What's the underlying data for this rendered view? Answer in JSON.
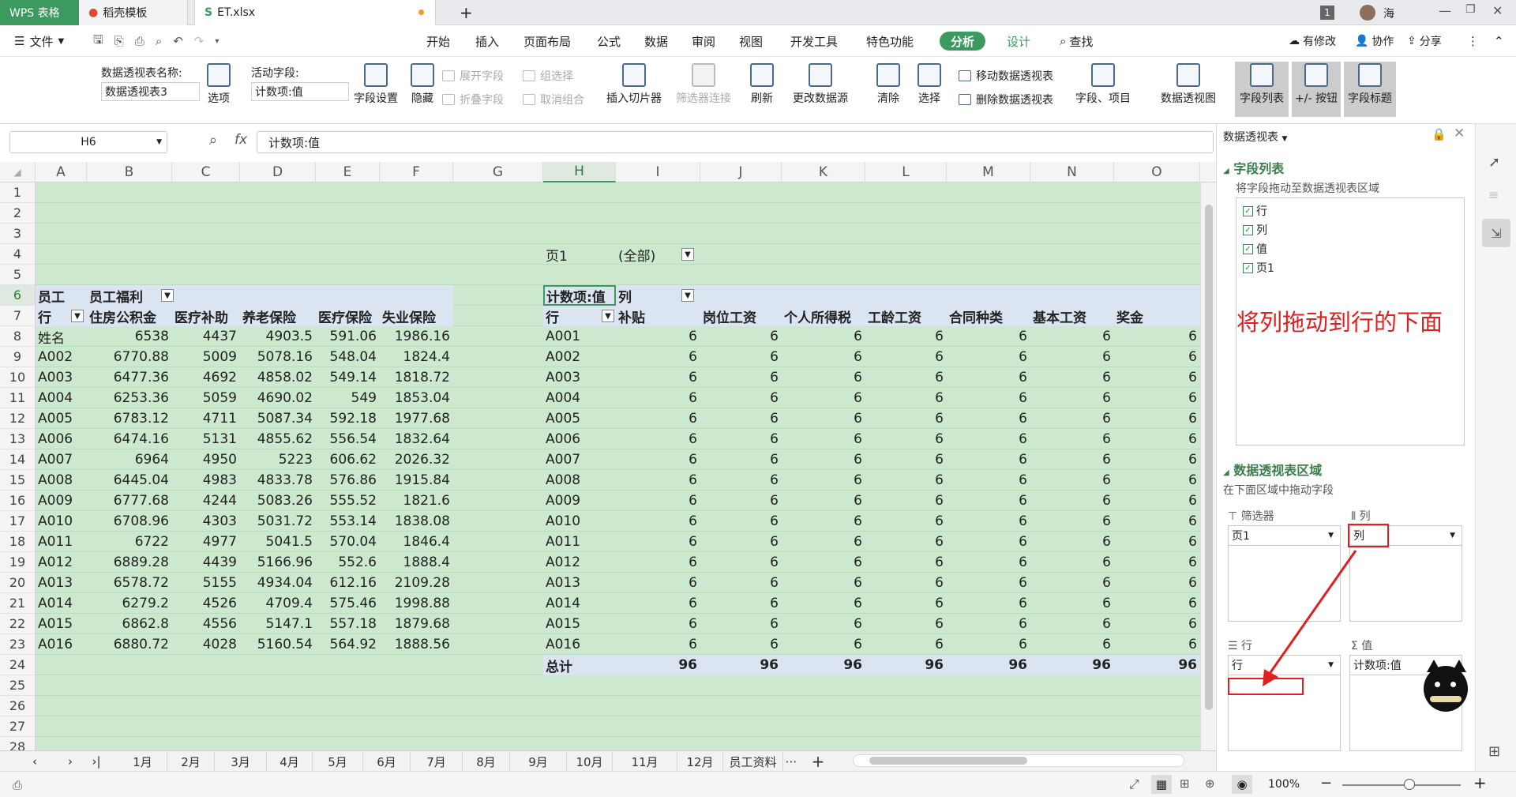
{
  "titlebar": {
    "tab_wps": "WPS 表格",
    "tab_daoke": "稻壳模板",
    "tab_file": "ET.xlsx",
    "new_tab": "+",
    "window_badge": "1",
    "user": "海"
  },
  "menu": {
    "file": "文件",
    "items": [
      "开始",
      "插入",
      "页面布局",
      "公式",
      "数据",
      "审阅",
      "视图",
      "开发工具",
      "特色功能",
      "分析",
      "设计"
    ],
    "search": "查找",
    "has_changes": "有修改",
    "collab": "协作",
    "share": "分享"
  },
  "ribbon": {
    "pivot_name_label": "数据透视表名称:",
    "pivot_name_value": "数据透视表3",
    "options": "选项",
    "active_field_label": "活动字段:",
    "active_field_value": "计数项:值",
    "field_settings": "字段设置",
    "hide": "隐藏",
    "expand_field": "展开字段",
    "collapse_field": "折叠字段",
    "group_select": "组选择",
    "ungroup": "取消组合",
    "insert_slicer": "插入切片器",
    "filter_connect": "筛选器连接",
    "refresh": "刷新",
    "change_source": "更改数据源",
    "clear": "清除",
    "select": "选择",
    "move_pivot": "移动数据透视表",
    "delete_pivot": "删除数据透视表",
    "fields_items": "字段、项目",
    "pivot_chart": "数据透视图",
    "field_list": "字段列表",
    "plus_minus": "+/- 按钮",
    "field_headers": "字段标题"
  },
  "formula": {
    "cell_ref": "H6",
    "fx": "fx",
    "content": "计数项:值"
  },
  "columns": [
    "A",
    "B",
    "C",
    "D",
    "E",
    "F",
    "G",
    "H",
    "I",
    "J",
    "K",
    "L",
    "M",
    "N",
    "O"
  ],
  "left_table": {
    "title_a": "员工",
    "title_b": "员工福利",
    "headers": [
      "行",
      "住房公积金",
      "医疗补助",
      "养老保险",
      "医疗保险",
      "失业保险"
    ],
    "rows": [
      [
        "姓名",
        "6538",
        "4437",
        "4903.5",
        "591.06",
        "1986.16"
      ],
      [
        "A002",
        "6770.88",
        "5009",
        "5078.16",
        "548.04",
        "1824.4"
      ],
      [
        "A003",
        "6477.36",
        "4692",
        "4858.02",
        "549.14",
        "1818.72"
      ],
      [
        "A004",
        "6253.36",
        "5059",
        "4690.02",
        "549",
        "1853.04"
      ],
      [
        "A005",
        "6783.12",
        "4711",
        "5087.34",
        "592.18",
        "1977.68"
      ],
      [
        "A006",
        "6474.16",
        "5131",
        "4855.62",
        "556.54",
        "1832.64"
      ],
      [
        "A007",
        "6964",
        "4950",
        "5223",
        "606.62",
        "2026.32"
      ],
      [
        "A008",
        "6445.04",
        "4983",
        "4833.78",
        "576.86",
        "1915.84"
      ],
      [
        "A009",
        "6777.68",
        "4244",
        "5083.26",
        "555.52",
        "1821.6"
      ],
      [
        "A010",
        "6708.96",
        "4303",
        "5031.72",
        "553.14",
        "1838.08"
      ],
      [
        "A011",
        "6722",
        "4977",
        "5041.5",
        "570.04",
        "1846.4"
      ],
      [
        "A012",
        "6889.28",
        "4439",
        "5166.96",
        "552.6",
        "1888.4"
      ],
      [
        "A013",
        "6578.72",
        "5155",
        "4934.04",
        "612.16",
        "2109.28"
      ],
      [
        "A014",
        "6279.2",
        "4526",
        "4709.4",
        "575.46",
        "1998.88"
      ],
      [
        "A015",
        "6862.8",
        "4556",
        "5147.1",
        "557.18",
        "1879.68"
      ],
      [
        "A016",
        "6880.72",
        "4028",
        "5160.54",
        "564.92",
        "1888.56"
      ]
    ]
  },
  "pivot": {
    "page_label": "页1",
    "page_value": "(全部)",
    "count_label": "计数项:值",
    "col_label": "列",
    "row_label": "行",
    "headers": [
      "补贴",
      "岗位工资",
      "个人所得税",
      "工龄工资",
      "合同种类",
      "基本工资",
      "奖金"
    ],
    "rows": [
      "A001",
      "A002",
      "A003",
      "A004",
      "A005",
      "A006",
      "A007",
      "A008",
      "A009",
      "A010",
      "A011",
      "A012",
      "A013",
      "A014",
      "A015",
      "A016"
    ],
    "cell_value": "6",
    "total_label": "总计",
    "total_value": "96"
  },
  "sheet_tabs": [
    "1月",
    "2月",
    "3月",
    "4月",
    "5月",
    "6月",
    "7月",
    "8月",
    "9月",
    "10月",
    "11月",
    "12月",
    "员工资料"
  ],
  "status": {
    "zoom": "100%"
  },
  "panel": {
    "title": "数据透视表",
    "field_list": "字段列表",
    "field_list_hint": "将字段拖动至数据透视表区域",
    "fields": [
      "行",
      "列",
      "值",
      "页1"
    ],
    "annotation": "将列拖动到行的下面",
    "area_title": "数据透视表区域",
    "area_hint": "在下面区域中拖动字段",
    "filter_label": "筛选器",
    "filter_value": "页1",
    "col_label": "列",
    "col_value": "列",
    "row_label": "行",
    "row_value": "行",
    "val_label": "值",
    "val_value": "计数项:值"
  },
  "colors": {
    "green_tab": "#3c9a5f",
    "cell_bg": "#cce8cf",
    "annotation": "#e02020"
  }
}
